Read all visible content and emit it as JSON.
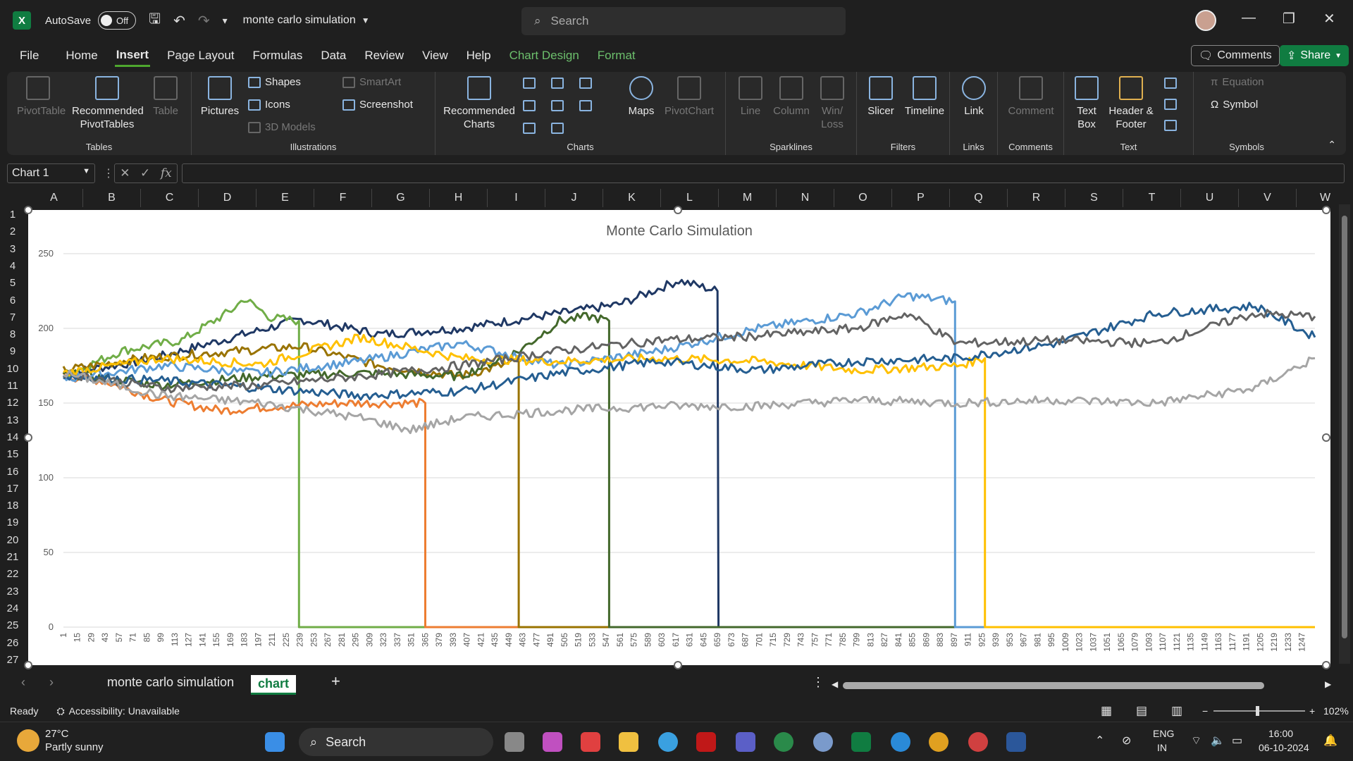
{
  "titlebar": {
    "autosave_label": "AutoSave",
    "autosave_state": "Off",
    "doc_name": "monte carlo simulation",
    "search_placeholder": "Search"
  },
  "menu": {
    "items": [
      "File",
      "Home",
      "Insert",
      "Page Layout",
      "Formulas",
      "Data",
      "Review",
      "View",
      "Help",
      "Chart Design",
      "Format"
    ],
    "active": "Insert",
    "comments": "Comments",
    "share": "Share"
  },
  "ribbon": {
    "tables": {
      "label": "Tables",
      "pivottable": "PivotTable",
      "recommended_pivot": "Recommended PivotTables",
      "table": "Table"
    },
    "illustrations": {
      "label": "Illustrations",
      "pictures": "Pictures",
      "shapes": "Shapes",
      "icons": "Icons",
      "models": "3D Models",
      "smartart": "SmartArt",
      "screenshot": "Screenshot"
    },
    "charts": {
      "label": "Charts",
      "recommended": "Recommended Charts",
      "maps": "Maps",
      "pivotchart": "PivotChart"
    },
    "sparklines": {
      "label": "Sparklines",
      "line": "Line",
      "column": "Column",
      "winloss": "Win/ Loss"
    },
    "filters": {
      "label": "Filters",
      "slicer": "Slicer",
      "timeline": "Timeline"
    },
    "links": {
      "label": "Links",
      "link": "Link"
    },
    "comments": {
      "label": "Comments",
      "comment": "Comment"
    },
    "text": {
      "label": "Text",
      "textbox": "Text Box",
      "headerfooter": "Header & Footer"
    },
    "symbols": {
      "label": "Symbols",
      "equation": "Equation",
      "symbol": "Symbol"
    }
  },
  "formula": {
    "name_box": "Chart 1",
    "fx": "fx"
  },
  "columns": [
    "A",
    "B",
    "C",
    "D",
    "E",
    "F",
    "G",
    "H",
    "I",
    "J",
    "K",
    "L",
    "M",
    "N",
    "O",
    "P",
    "Q",
    "R",
    "S",
    "T",
    "U",
    "V",
    "W"
  ],
  "rows": [
    "1",
    "2",
    "3",
    "4",
    "5",
    "6",
    "7",
    "8",
    "9",
    "10",
    "11",
    "12",
    "13",
    "14",
    "15",
    "16",
    "17",
    "18",
    "19",
    "20",
    "21",
    "22",
    "23",
    "24",
    "25",
    "26",
    "27"
  ],
  "chart_data": {
    "type": "line",
    "title": "Monte Carlo Simulation",
    "ylim": [
      0,
      250
    ],
    "yticks": [
      0,
      50,
      100,
      150,
      200,
      250
    ],
    "x_ticks": [
      1,
      15,
      29,
      43,
      57,
      71,
      85,
      99,
      113,
      127,
      141,
      155,
      169,
      183,
      197,
      211,
      225,
      239,
      253,
      267,
      281,
      295,
      309,
      323,
      337,
      351,
      365,
      379,
      393,
      407,
      421,
      435,
      449,
      463,
      477,
      491,
      505,
      519,
      533,
      547,
      561,
      575,
      589,
      603,
      617,
      631,
      645,
      659,
      673,
      687,
      701,
      715,
      729,
      743,
      757,
      771,
      785,
      799,
      813,
      827,
      841,
      855,
      869,
      883,
      897,
      911,
      925,
      939,
      953,
      967,
      981,
      995,
      1009,
      1023,
      1037,
      1051,
      1065,
      1079,
      1093,
      1107,
      1121,
      1135,
      1149,
      1163,
      1177,
      1191,
      1205,
      1219,
      1233,
      1247
    ],
    "x_max": 1260,
    "grid": true,
    "series": [
      {
        "color": "#1f3864",
        "drop_at": 660,
        "points": [
          [
            1,
            170
          ],
          [
            80,
            178
          ],
          [
            160,
            192
          ],
          [
            240,
            206
          ],
          [
            320,
            196
          ],
          [
            400,
            200
          ],
          [
            480,
            208
          ],
          [
            560,
            216
          ],
          [
            620,
            232
          ],
          [
            659,
            225
          ]
        ]
      },
      {
        "color": "#70ad47",
        "drop_at": 238,
        "points": [
          [
            1,
            168
          ],
          [
            60,
            185
          ],
          [
            120,
            192
          ],
          [
            170,
            212
          ],
          [
            183,
            220
          ],
          [
            210,
            207
          ],
          [
            238,
            205
          ]
        ]
      },
      {
        "color": "#ed7d31",
        "drop_at": 365,
        "points": [
          [
            1,
            168
          ],
          [
            40,
            165
          ],
          [
            100,
            152
          ],
          [
            160,
            145
          ],
          [
            220,
            148
          ],
          [
            280,
            150
          ],
          [
            330,
            150
          ],
          [
            365,
            150
          ]
        ]
      },
      {
        "color": "#997300",
        "drop_at": 459,
        "points": [
          [
            1,
            172
          ],
          [
            80,
            180
          ],
          [
            160,
            184
          ],
          [
            240,
            188
          ],
          [
            320,
            175
          ],
          [
            400,
            168
          ],
          [
            459,
            178
          ]
        ]
      },
      {
        "color": "#43682b",
        "drop_at": 550,
        "points": [
          [
            1,
            170
          ],
          [
            100,
            162
          ],
          [
            200,
            168
          ],
          [
            300,
            170
          ],
          [
            400,
            168
          ],
          [
            460,
            185
          ],
          [
            500,
            205
          ],
          [
            530,
            208
          ],
          [
            550,
            205
          ]
        ]
      },
      {
        "color": "#5b9bd5",
        "drop_at": 898,
        "points": [
          [
            1,
            166
          ],
          [
            100,
            175
          ],
          [
            200,
            170
          ],
          [
            300,
            178
          ],
          [
            400,
            190
          ],
          [
            500,
            175
          ],
          [
            600,
            185
          ],
          [
            700,
            200
          ],
          [
            800,
            210
          ],
          [
            850,
            222
          ],
          [
            898,
            218
          ]
        ]
      },
      {
        "color": "#ffc000",
        "drop_at": 928,
        "points": [
          [
            1,
            170
          ],
          [
            100,
            180
          ],
          [
            200,
            176
          ],
          [
            300,
            194
          ],
          [
            400,
            180
          ],
          [
            500,
            178
          ],
          [
            600,
            180
          ],
          [
            700,
            178
          ],
          [
            800,
            172
          ],
          [
            900,
            175
          ],
          [
            928,
            180
          ]
        ]
      },
      {
        "color": "#255e91",
        "drop_at": null,
        "points": [
          [
            1,
            168
          ],
          [
            100,
            165
          ],
          [
            200,
            160
          ],
          [
            300,
            155
          ],
          [
            400,
            158
          ],
          [
            500,
            170
          ],
          [
            600,
            178
          ],
          [
            700,
            172
          ],
          [
            800,
            178
          ],
          [
            900,
            180
          ],
          [
            1000,
            190
          ],
          [
            1100,
            210
          ],
          [
            1200,
            215
          ],
          [
            1260,
            194
          ]
        ]
      },
      {
        "color": "#636363",
        "drop_at": null,
        "points": [
          [
            1,
            170
          ],
          [
            100,
            160
          ],
          [
            200,
            162
          ],
          [
            300,
            168
          ],
          [
            400,
            175
          ],
          [
            500,
            185
          ],
          [
            600,
            192
          ],
          [
            700,
            195
          ],
          [
            800,
            200
          ],
          [
            850,
            210
          ],
          [
            900,
            190
          ],
          [
            1000,
            192
          ],
          [
            1100,
            190
          ],
          [
            1200,
            210
          ],
          [
            1260,
            208
          ]
        ]
      },
      {
        "color": "#a5a5a5",
        "drop_at": null,
        "points": [
          [
            1,
            170
          ],
          [
            100,
            155
          ],
          [
            200,
            150
          ],
          [
            300,
            140
          ],
          [
            350,
            132
          ],
          [
            400,
            140
          ],
          [
            500,
            145
          ],
          [
            600,
            148
          ],
          [
            700,
            148
          ],
          [
            800,
            152
          ],
          [
            900,
            150
          ],
          [
            1000,
            152
          ],
          [
            1100,
            150
          ],
          [
            1200,
            160
          ],
          [
            1260,
            180
          ]
        ]
      }
    ]
  },
  "sheet_tabs": {
    "tab1": "monte carlo simulation",
    "tab2": "chart",
    "add": "+"
  },
  "status": {
    "ready": "Ready",
    "accessibility": "Accessibility: Unavailable",
    "zoom": "102%"
  },
  "taskbar": {
    "temp": "27°C",
    "weather": "Partly sunny",
    "search": "Search",
    "lang1": "ENG",
    "lang2": "IN",
    "time": "16:00",
    "date": "06-10-2024"
  }
}
